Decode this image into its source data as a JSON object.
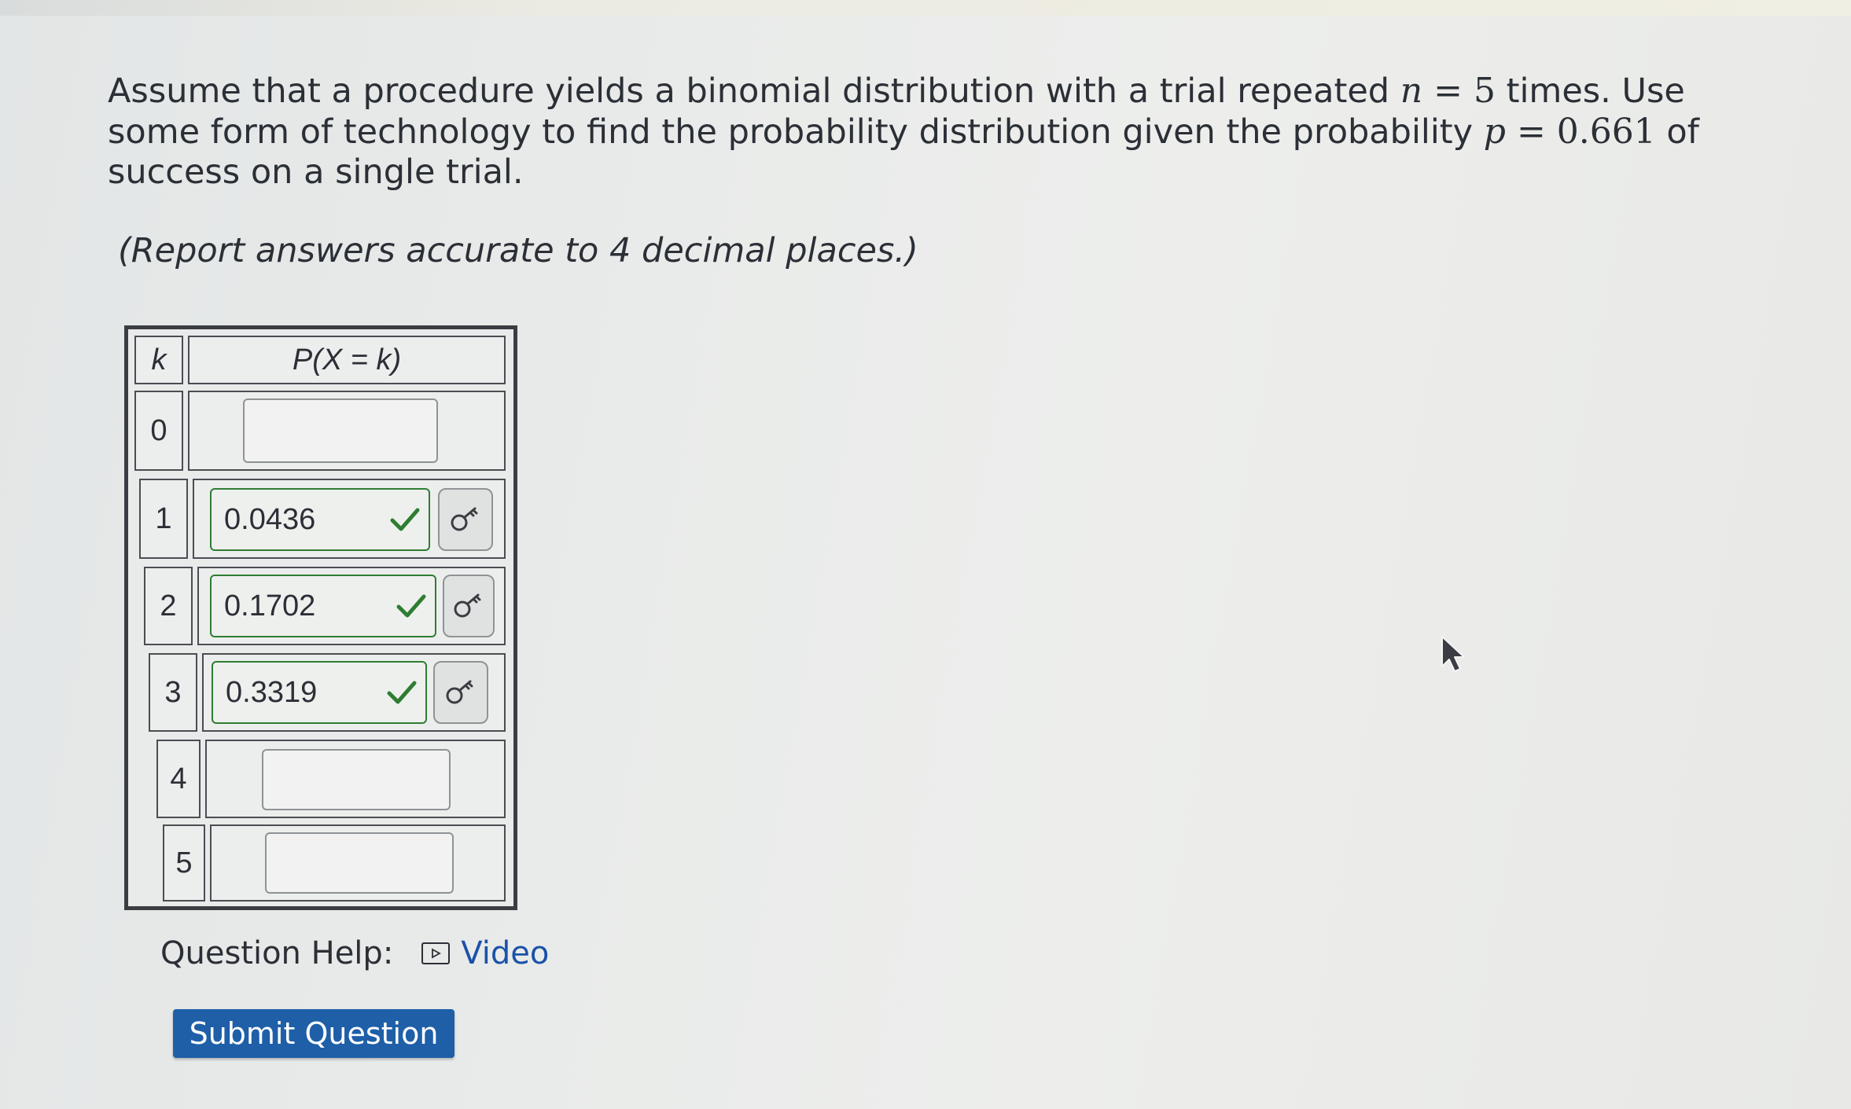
{
  "question": {
    "part1": "Assume that a procedure yields a binomial distribution with a trial repeated ",
    "n_var": "n",
    "n_eq": " = 5",
    "part2": " times. Use some form of technology to find the probability distribution given the probability ",
    "p_var": "p",
    "p_eq": " = 0.661",
    "part3": " of success on a single trial."
  },
  "instruction": "(Report answers accurate to 4 decimal places.)",
  "table": {
    "header_k": "k",
    "header_p": "P(X = k)",
    "rows": [
      {
        "k": "0",
        "value": "",
        "status": "empty"
      },
      {
        "k": "1",
        "value": "0.0436",
        "status": "correct"
      },
      {
        "k": "2",
        "value": "0.1702",
        "status": "correct"
      },
      {
        "k": "3",
        "value": "0.3319",
        "status": "correct"
      },
      {
        "k": "4",
        "value": "",
        "status": "empty"
      },
      {
        "k": "5",
        "value": "",
        "status": "empty"
      }
    ]
  },
  "help": {
    "label": "Question Help:",
    "video_label": "Video"
  },
  "submit_label": "Submit Question",
  "colors": {
    "correct": "#2e7d32",
    "link": "#1a52a8",
    "submit": "#1e5fa8"
  },
  "icons": {
    "check": "check-icon",
    "key": "key-icon",
    "video": "video-icon",
    "cursor": "mouse-cursor-icon"
  }
}
